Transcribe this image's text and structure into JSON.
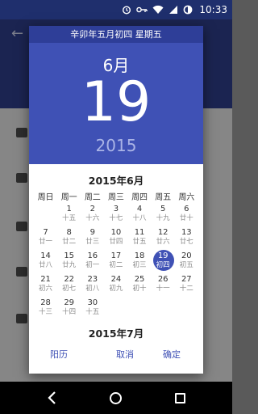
{
  "status_bar": {
    "time": "10:33",
    "icons": [
      "alarm-icon",
      "key-icon",
      "wifi-icon",
      "signal-icon",
      "battery-icon"
    ]
  },
  "dialog": {
    "lunar_header": "辛卯年五月初四 星期五",
    "selected_month": "6月",
    "selected_day": "19",
    "selected_year": "2015",
    "calendar_title": "2015年6月",
    "weekdays": [
      "周日",
      "周一",
      "周二",
      "周三",
      "周四",
      "周五",
      "周六"
    ],
    "weeks": [
      [
        null,
        {
          "d": "1",
          "l": "十五"
        },
        {
          "d": "2",
          "l": "十六"
        },
        {
          "d": "3",
          "l": "十七"
        },
        {
          "d": "4",
          "l": "十八"
        },
        {
          "d": "5",
          "l": "十九"
        },
        {
          "d": "6",
          "l": "廿十"
        }
      ],
      [
        {
          "d": "7",
          "l": "廿一"
        },
        {
          "d": "8",
          "l": "廿二"
        },
        {
          "d": "9",
          "l": "廿三"
        },
        {
          "d": "10",
          "l": "廿四"
        },
        {
          "d": "11",
          "l": "廿五"
        },
        {
          "d": "12",
          "l": "廿六"
        },
        {
          "d": "13",
          "l": "廿七"
        }
      ],
      [
        {
          "d": "14",
          "l": "廿八"
        },
        {
          "d": "15",
          "l": "廿九"
        },
        {
          "d": "16",
          "l": "初一"
        },
        {
          "d": "17",
          "l": "初二"
        },
        {
          "d": "18",
          "l": "初三"
        },
        {
          "d": "19",
          "l": "初四",
          "selected": true
        },
        {
          "d": "20",
          "l": "初五"
        }
      ],
      [
        {
          "d": "21",
          "l": "初六"
        },
        {
          "d": "22",
          "l": "初七"
        },
        {
          "d": "23",
          "l": "初八"
        },
        {
          "d": "24",
          "l": "初九"
        },
        {
          "d": "25",
          "l": "初十"
        },
        {
          "d": "26",
          "l": "十一"
        },
        {
          "d": "27",
          "l": "十二"
        }
      ],
      [
        {
          "d": "28",
          "l": "十三"
        },
        {
          "d": "29",
          "l": "十四"
        },
        {
          "d": "30",
          "l": "十五"
        },
        null,
        null,
        null,
        null
      ]
    ],
    "next_month_title": "2015年7月",
    "buttons": {
      "lunar": "阳历",
      "cancel": "取消",
      "ok": "确定"
    }
  },
  "colors": {
    "accent": "#3f51b5",
    "header_dark": "#2e3e98",
    "year_text": "#aab4e6"
  }
}
